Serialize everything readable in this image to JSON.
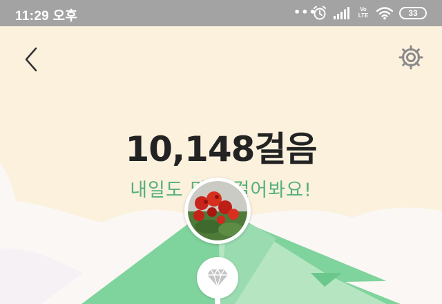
{
  "status_bar": {
    "time": "11:29 오후",
    "dots": "•••",
    "volte_top": "Vo",
    "volte_bottom": "LTE",
    "battery": "33",
    "icons": [
      "alarm-icon",
      "signal-icon",
      "wifi-icon",
      "battery-icon"
    ]
  },
  "header": {
    "back_icon": "chevron-left-icon",
    "settings_icon": "gear-icon"
  },
  "steps": {
    "count": "10,148걸음",
    "message": "내일도 많이 걸어봐요!"
  },
  "badges": {
    "avatar": "flower-icon",
    "gem": "diamond-icon"
  },
  "colors": {
    "background": "#fbf1dd",
    "status_bar": "#a3a3a3",
    "accent_green": "#55b07d",
    "mountain": "#7fd39d",
    "text_dark": "#232323"
  }
}
